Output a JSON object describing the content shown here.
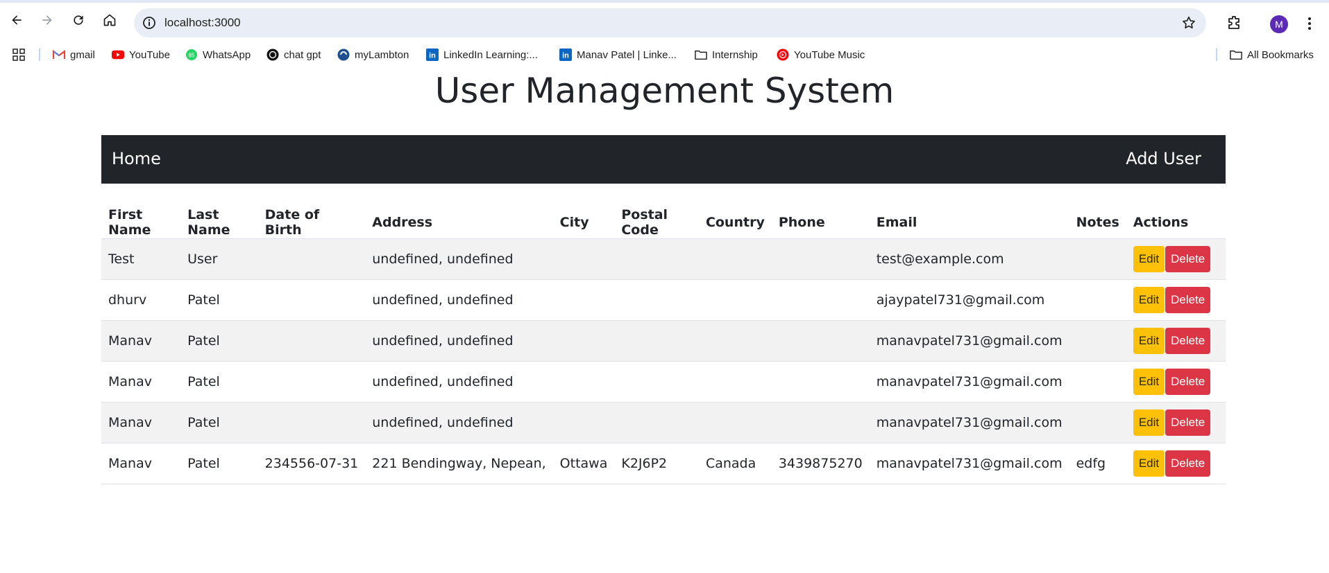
{
  "browser": {
    "url": "localhost:3000",
    "profile_initial": "M",
    "bookmarks": [
      {
        "label": "gmail",
        "icon": "gmail-icon"
      },
      {
        "label": "YouTube",
        "icon": "youtube-icon"
      },
      {
        "label": "WhatsApp",
        "icon": "whatsapp-icon"
      },
      {
        "label": "chat gpt",
        "icon": "chatgpt-icon"
      },
      {
        "label": "myLambton",
        "icon": "mylambton-icon"
      },
      {
        "label": "LinkedIn Learning:...",
        "icon": "linkedin-icon"
      },
      {
        "label": "Manav Patel | Linke...",
        "icon": "linkedin-icon"
      },
      {
        "label": "Internship",
        "icon": "folder-icon"
      },
      {
        "label": "YouTube Music",
        "icon": "youtube-music-icon"
      }
    ],
    "all_bookmarks": "All Bookmarks"
  },
  "page": {
    "title": "User Management System",
    "nav": {
      "home": "Home",
      "add_user": "Add User"
    }
  },
  "table": {
    "headers": [
      "First Name",
      "Last Name",
      "Date of Birth",
      "Address",
      "City",
      "Postal Code",
      "Country",
      "Phone",
      "Email",
      "Notes",
      "Actions"
    ],
    "edit_label": "Edit",
    "delete_label": "Delete",
    "rows": [
      {
        "first": "Test",
        "last": "User",
        "dob": "",
        "address": "undefined, undefined",
        "city": "",
        "postal": "",
        "country": "",
        "phone": "",
        "email": "test@example.com",
        "notes": ""
      },
      {
        "first": "dhurv",
        "last": "Patel",
        "dob": "",
        "address": "undefined, undefined",
        "city": "",
        "postal": "",
        "country": "",
        "phone": "",
        "email": "ajaypatel731@gmail.com",
        "notes": ""
      },
      {
        "first": "Manav",
        "last": "Patel",
        "dob": "",
        "address": "undefined, undefined",
        "city": "",
        "postal": "",
        "country": "",
        "phone": "",
        "email": "manavpatel731@gmail.com",
        "notes": ""
      },
      {
        "first": "Manav",
        "last": "Patel",
        "dob": "",
        "address": "undefined, undefined",
        "city": "",
        "postal": "",
        "country": "",
        "phone": "",
        "email": "manavpatel731@gmail.com",
        "notes": ""
      },
      {
        "first": "Manav",
        "last": "Patel",
        "dob": "",
        "address": "undefined, undefined",
        "city": "",
        "postal": "",
        "country": "",
        "phone": "",
        "email": "manavpatel731@gmail.com",
        "notes": ""
      },
      {
        "first": "Manav",
        "last": "Patel",
        "dob": "234556-07-31",
        "address": "221 Bendingway, Nepean,",
        "city": "Ottawa",
        "postal": "K2J6P2",
        "country": "Canada",
        "phone": "3439875270",
        "email": "manavpatel731@gmail.com",
        "notes": "edfg"
      }
    ]
  },
  "colors": {
    "navbar": "#212529",
    "edit": "#ffc107",
    "delete": "#dc3545",
    "stripe": "#f2f2f2"
  }
}
